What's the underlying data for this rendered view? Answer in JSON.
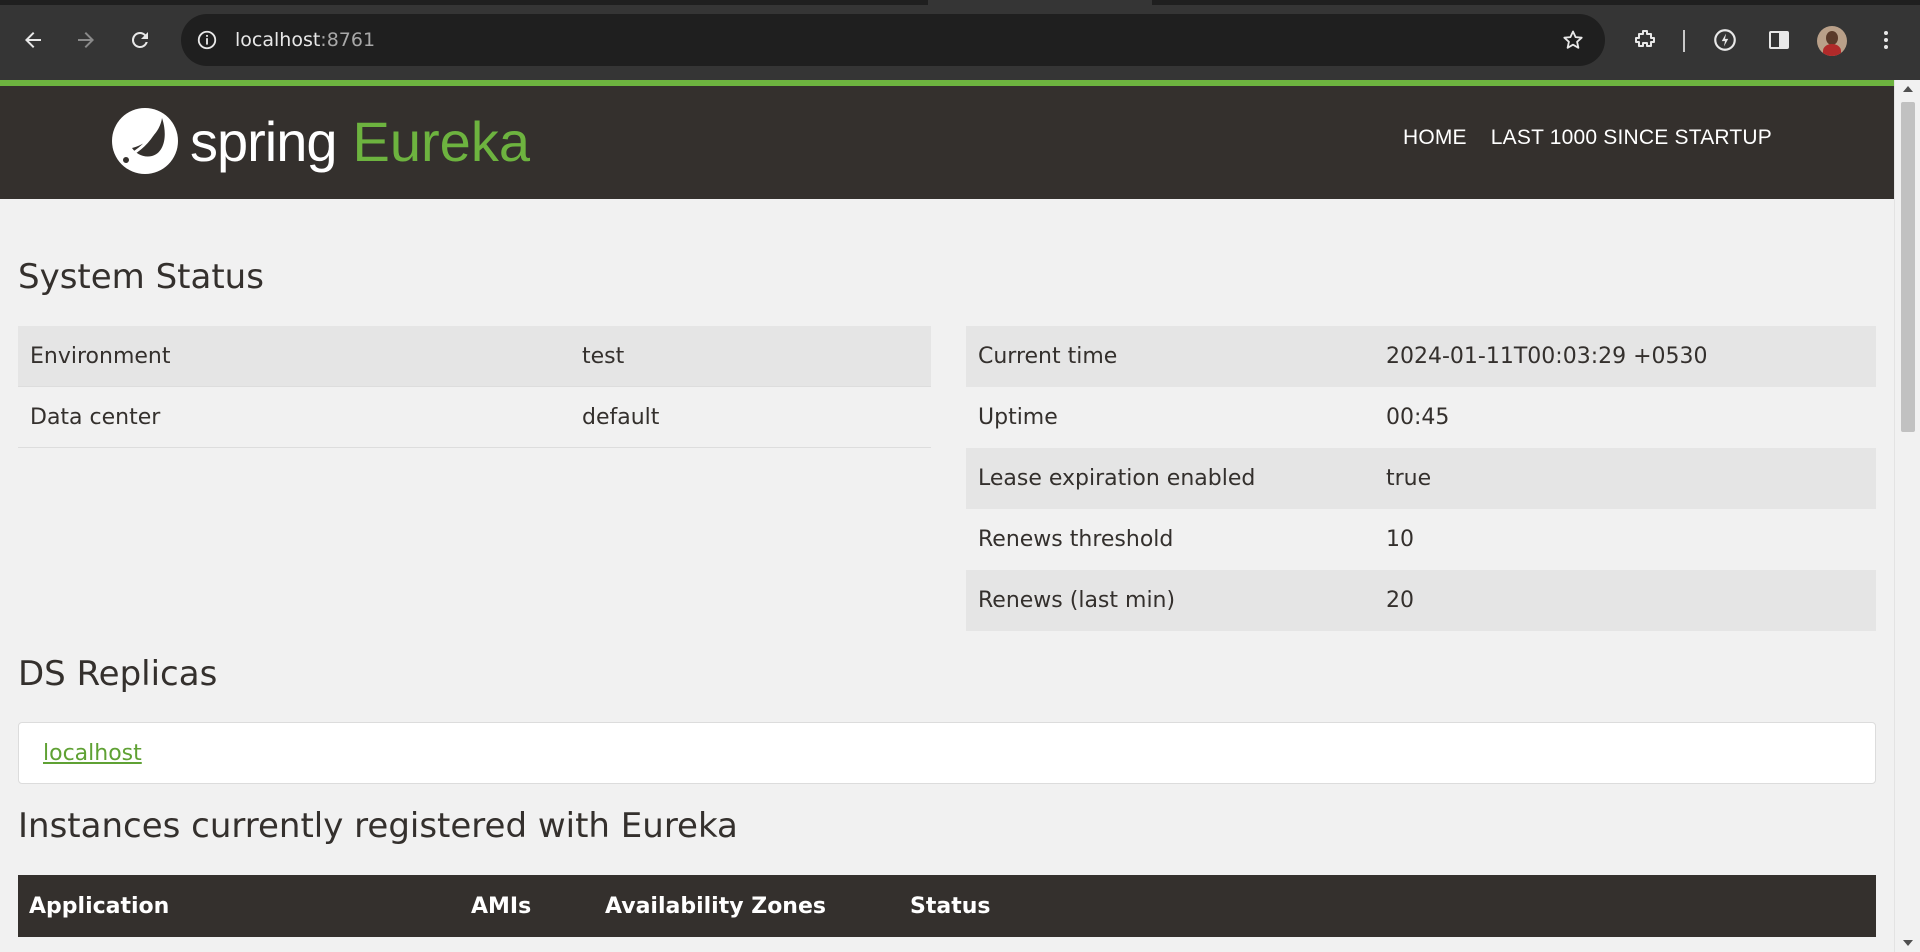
{
  "browser": {
    "url_host": "localhost",
    "url_port": ":8761",
    "icons": {
      "back": "arrow-left-icon",
      "forward": "arrow-right-icon",
      "reload": "reload-icon",
      "site_info": "info-icon",
      "bookmark": "star-icon",
      "extensions": "puzzle-icon",
      "performance": "speedometer-icon",
      "side_panel": "side-panel-icon",
      "menu": "kebab-icon"
    }
  },
  "navbar": {
    "brand_spring": "spring",
    "brand_eureka": "Eureka",
    "links": [
      "HOME",
      "LAST 1000 SINCE STARTUP"
    ]
  },
  "system_status": {
    "title": "System Status",
    "left": [
      {
        "key": "Environment",
        "value": "test"
      },
      {
        "key": "Data center",
        "value": "default"
      }
    ],
    "right": [
      {
        "key": "Current time",
        "value": "2024-01-11T00:03:29 +0530"
      },
      {
        "key": "Uptime",
        "value": "00:45"
      },
      {
        "key": "Lease expiration enabled",
        "value": "true"
      },
      {
        "key": "Renews threshold",
        "value": "10"
      },
      {
        "key": "Renews (last min)",
        "value": "20"
      }
    ]
  },
  "ds_replicas": {
    "title": "DS Replicas",
    "link": "localhost"
  },
  "instances": {
    "title": "Instances currently registered with Eureka",
    "columns": [
      "Application",
      "AMIs",
      "Availability Zones",
      "Status"
    ]
  },
  "colors": {
    "brand_green": "#6db33f",
    "navbar_bg": "#34302d",
    "page_bg": "#f1f1f1"
  }
}
